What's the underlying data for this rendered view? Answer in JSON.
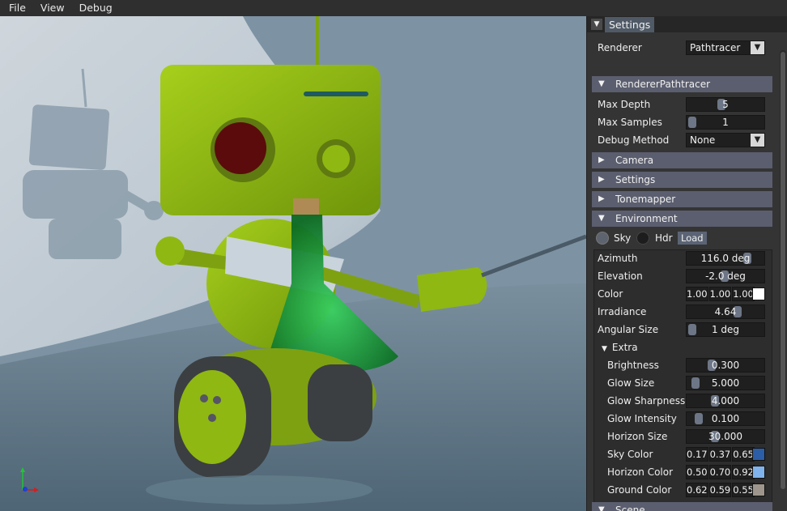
{
  "menu": [
    "File",
    "View",
    "Debug"
  ],
  "panel": {
    "tab_title": "Settings",
    "renderer": {
      "label": "Renderer",
      "value": "Pathtracer"
    },
    "sections": {
      "renderer_pathtracer": "RendererPathtracer",
      "camera": "Camera",
      "settings": "Settings",
      "tonemapper": "Tonemapper",
      "environment": "Environment",
      "scene": "Scene"
    },
    "pathtracer": {
      "max_depth": {
        "label": "Max Depth",
        "value": "5",
        "level": 0.45
      },
      "max_samples": {
        "label": "Max Samples",
        "value": "1",
        "level": 0.0
      },
      "debug_method": {
        "label": "Debug Method",
        "value": "None"
      }
    },
    "env_type": {
      "sky": "Sky",
      "hdr": "Hdr",
      "load": "Load",
      "selected": "sky"
    },
    "environment": {
      "azimuth": {
        "label": "Azimuth",
        "value": "116.0 deg",
        "level": 0.72
      },
      "elevation": {
        "label": "Elevation",
        "value": "-2.0 deg",
        "level": 0.48
      },
      "color": {
        "label": "Color",
        "values": [
          "1.00",
          "1.00",
          "1.00"
        ],
        "swatch": "#ffffff"
      },
      "irradiance": {
        "label": "Irradiance",
        "value": "4.64",
        "level": 0.62
      },
      "angular_size": {
        "label": "Angular Size",
        "value": "1 deg",
        "level": 0.0
      }
    },
    "extra": {
      "title": "Extra",
      "brightness": {
        "label": "Brightness",
        "value": "0.300",
        "level": 0.3
      },
      "glow_size": {
        "label": "Glow Size",
        "value": "5.000",
        "level": 0.05
      },
      "glow_sharpness": {
        "label": "Glow Sharpness",
        "value": "4.000",
        "level": 0.35
      },
      "glow_intensity": {
        "label": "Glow Intensity",
        "value": "0.100",
        "level": 0.1
      },
      "horizon_size": {
        "label": "Horizon Size",
        "value": "30.000",
        "level": 0.33
      },
      "sky_color": {
        "label": "Sky Color",
        "values": [
          "0.17",
          "0.37",
          "0.65"
        ],
        "swatch": "#2b5ea6"
      },
      "horizon_color": {
        "label": "Horizon Color",
        "values": [
          "0.50",
          "0.70",
          "0.92"
        ],
        "swatch": "#80b3eb"
      },
      "ground_color": {
        "label": "Ground Color",
        "values": [
          "0.62",
          "0.59",
          "0.55"
        ],
        "swatch": "#9e968c"
      }
    }
  },
  "colors": {
    "header": "#5b5e6e",
    "accent": "#4f5a66",
    "robot_green": "#8fb812"
  },
  "viewport": {
    "content": "Path-traced 3D render of green robot holding a glass flask",
    "axis_icon": "xyz-axes-gizmo"
  }
}
